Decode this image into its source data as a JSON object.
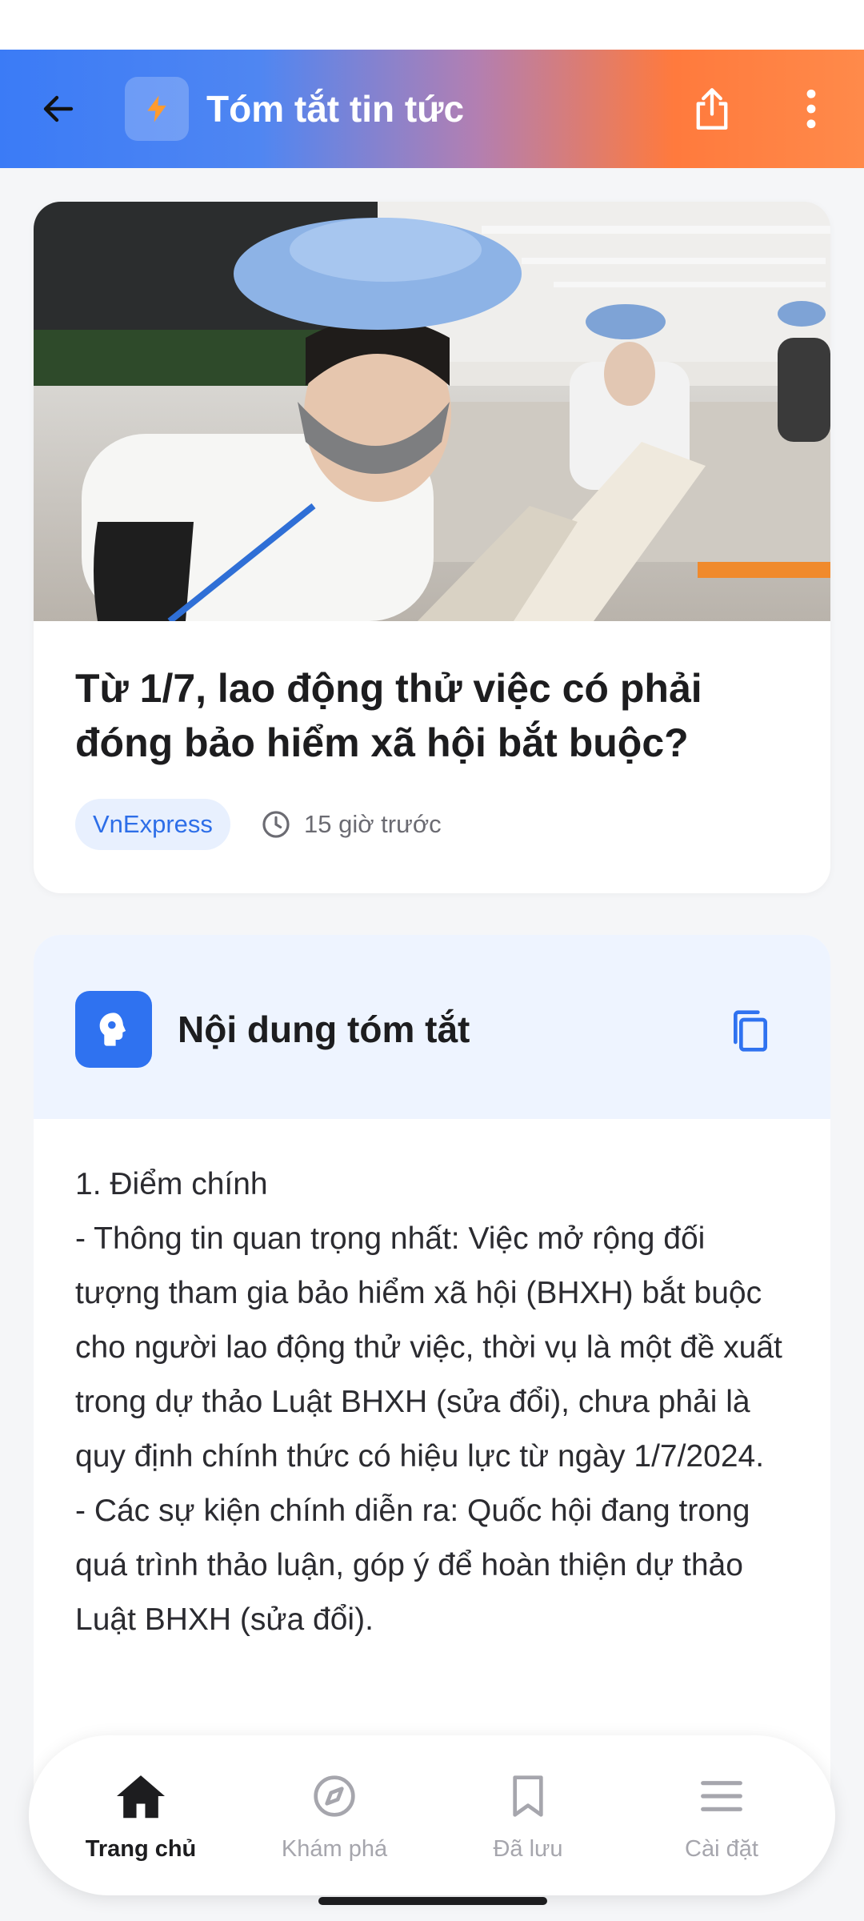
{
  "app_bar": {
    "title": "Tóm tắt tin tức",
    "gradient_colors": [
      "#3b7bf6",
      "#ff7a3d"
    ]
  },
  "article": {
    "headline": "Từ 1/7, lao động thử việc có phải đóng bảo hiểm xã hội bắt buộc?",
    "source": "VnExpress",
    "time_ago": "15 giờ trước"
  },
  "summary": {
    "title": "Nội dung tóm tắt",
    "lines": [
      "1. Điểm chính",
      "- Thông tin quan trọng nhất: Việc mở rộng đối tượng tham gia bảo hiểm xã hội (BHXH) bắt buộc cho người lao động thử việc, thời vụ là một đề xuất trong dự thảo Luật BHXH (sửa đổi), chưa phải là quy định chính thức có hiệu lực từ ngày 1/7/2024.",
      "- Các sự kiện chính diễn ra: Quốc hội đang trong quá trình thảo luận, góp ý để hoàn thiện dự thảo Luật BHXH (sửa đổi)."
    ]
  },
  "bottom_nav": {
    "items": [
      {
        "label": "Trang chủ",
        "icon": "home-icon",
        "active": true
      },
      {
        "label": "Khám phá",
        "icon": "compass-icon",
        "active": false
      },
      {
        "label": "Đã lưu",
        "icon": "bookmark-icon",
        "active": false
      },
      {
        "label": "Cài đặt",
        "icon": "menu-icon",
        "active": false
      }
    ]
  },
  "colors": {
    "accent": "#2f72f0",
    "chip_bg": "#e8f0fe",
    "summary_header_bg": "#eef4ff"
  }
}
